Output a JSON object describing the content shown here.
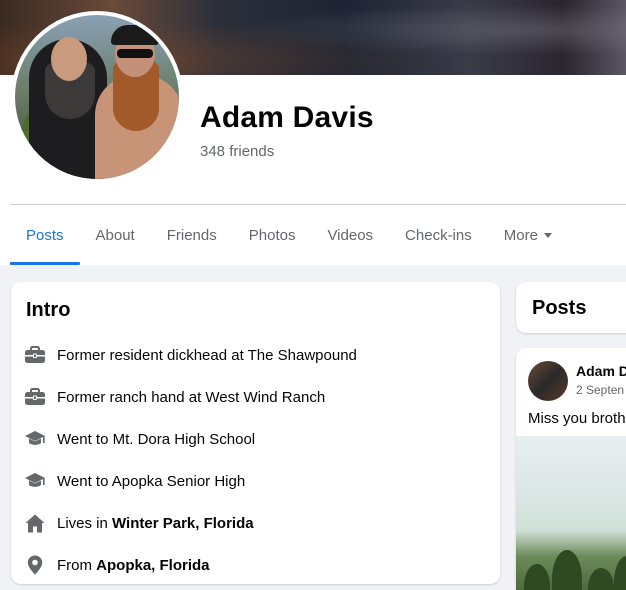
{
  "profile": {
    "name": "Adam Davis",
    "friends": "348 friends"
  },
  "tabs": [
    {
      "label": "Posts",
      "active": true
    },
    {
      "label": "About",
      "active": false
    },
    {
      "label": "Friends",
      "active": false
    },
    {
      "label": "Photos",
      "active": false
    },
    {
      "label": "Videos",
      "active": false
    },
    {
      "label": "Check-ins",
      "active": false
    },
    {
      "label": "More",
      "active": false
    }
  ],
  "intro": {
    "title": "Intro",
    "items": [
      {
        "icon": "briefcase-icon",
        "prefix": "Former resident dickhead at The Shawpound",
        "bold": ""
      },
      {
        "icon": "briefcase-icon",
        "prefix": "Former ranch hand at West Wind Ranch",
        "bold": ""
      },
      {
        "icon": "graduation-cap-icon",
        "prefix": "Went to Mt. Dora High School",
        "bold": ""
      },
      {
        "icon": "graduation-cap-icon",
        "prefix": "Went to Apopka Senior High",
        "bold": ""
      },
      {
        "icon": "home-icon",
        "prefix": "Lives in ",
        "bold": "Winter Park, Florida"
      },
      {
        "icon": "location-pin-icon",
        "prefix": "From ",
        "bold": "Apopka, Florida"
      }
    ]
  },
  "posts_header": {
    "title": "Posts"
  },
  "post": {
    "author": "Adam D",
    "date": "2 Septen",
    "text": "Miss you broth"
  },
  "colors": {
    "accent": "#1b74e4",
    "icon_gray": "#65676b",
    "background": "#f0f2f5"
  }
}
